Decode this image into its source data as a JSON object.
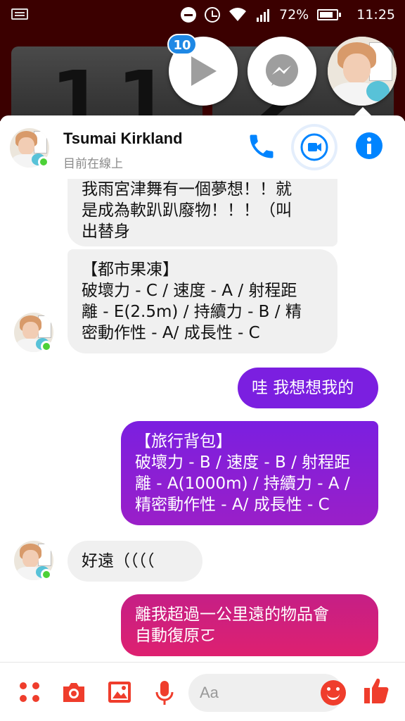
{
  "status_bar": {
    "battery_percent": "72%",
    "time": "11:25"
  },
  "background_clock": {
    "digits": [
      "1",
      "1",
      "2"
    ]
  },
  "chat_heads": {
    "badge_count": "10"
  },
  "conversation": {
    "contact_name": "Tsumai Kirkland",
    "presence": "目前在線上"
  },
  "messages": [
    {
      "direction": "incoming",
      "lines": [
        "我雨宮津舞有一個夢想！！就",
        "是成為軟趴趴廢物！！！（叫",
        "出替身"
      ]
    },
    {
      "direction": "incoming",
      "lines": [
        "【都市果凍】",
        "破壞力 - C / 速度 - A / 射程距",
        "離 - E(2.5m) / 持續力 - B / 精",
        "密動作性 - A/ 成長性 - C"
      ]
    },
    {
      "direction": "outgoing",
      "lines": [
        "哇 我想想我的"
      ]
    },
    {
      "direction": "outgoing",
      "lines": [
        "【旅行背包】",
        "破壞力 - B / 速度 - B / 射程距",
        "離 - A(1000m) / 持續力 - A /",
        "精密動作性 - A/ 成長性 - C"
      ]
    },
    {
      "direction": "incoming",
      "lines": [
        "好遠（（（（"
      ]
    },
    {
      "direction": "outgoing",
      "lines": [
        "離我超過一公里遠的物品會",
        "自動復原ㄛ"
      ]
    }
  ],
  "composer": {
    "placeholder": "Aa"
  },
  "colors": {
    "messenger_blue": "#0084ff",
    "composer_red": "#ef3d2c",
    "online_green": "#4cd137",
    "incoming_bubble": "#f0f0f0",
    "outgoing_purple": "#7b1fe0",
    "outgoing_pink": "#d61f7a"
  },
  "icons": {
    "header": [
      "phone-icon",
      "video-camera-icon",
      "info-icon"
    ],
    "composer": [
      "apps-grid-icon",
      "camera-icon",
      "gallery-icon",
      "microphone-icon",
      "emoji-icon",
      "thumbs-up-icon"
    ],
    "status": [
      "notification-icon",
      "do-not-disturb-icon",
      "alarm-icon",
      "wifi-icon",
      "signal-icon",
      "battery-icon"
    ]
  }
}
